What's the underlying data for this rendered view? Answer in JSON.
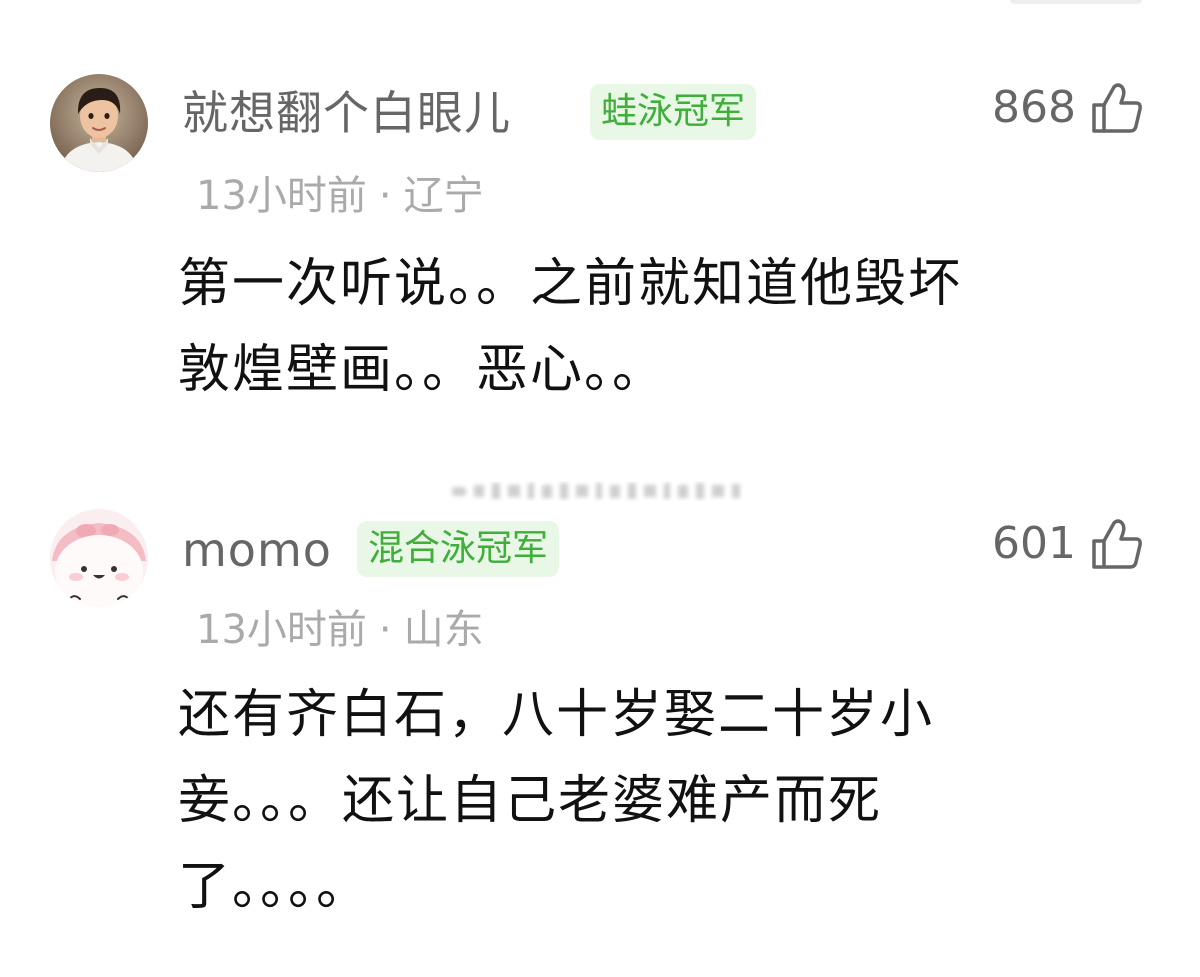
{
  "comments": [
    {
      "username": "就想翻个白眼儿",
      "badge": "蛙泳冠军",
      "likes": "868",
      "time": "13小时前",
      "separator": "·",
      "location": "辽宁",
      "lines": [
        "第一次听说。。之前就知道他毁坏",
        "敦煌壁画。。恶心。。"
      ],
      "avatar_icon": "child-photo-avatar-icon"
    },
    {
      "username": "momo",
      "badge": "混合泳冠军",
      "likes": "601",
      "time": "13小时前",
      "separator": "·",
      "location": "山东",
      "lines": [
        "还有齐白石，八十岁娶二十岁小",
        "妾。。。还让自己老婆难产而死",
        "了。。。。"
      ],
      "avatar_icon": "cartoon-face-avatar-icon"
    }
  ],
  "colors": {
    "username": "#666666",
    "badge_text": "#3fae3a",
    "badge_bg": "#e9f7e6",
    "meta": "#aaaaaa",
    "body": "#111111"
  },
  "icons": {
    "like": "thumbs-up-icon"
  }
}
